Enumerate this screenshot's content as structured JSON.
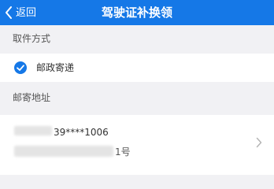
{
  "header": {
    "back_label": "返回",
    "title": "驾驶证补换领",
    "background_color": "#1578e7"
  },
  "pickup": {
    "section_title": "取件方式",
    "selected_option": "邮政寄递",
    "check_icon": "check-circle-icon"
  },
  "address": {
    "section_title": "邮寄地址",
    "phone_visible": "39****1006",
    "address_visible": "1号",
    "chevron_icon": "chevron-right-icon"
  }
}
